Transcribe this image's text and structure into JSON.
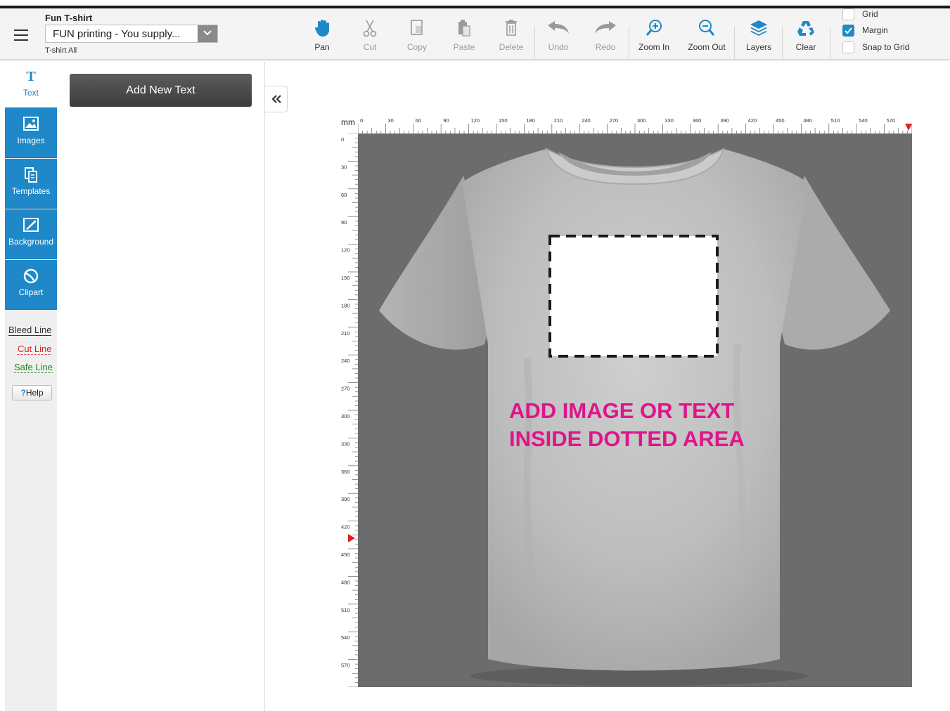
{
  "product": {
    "title": "Fun T-shirt",
    "selected_option": "FUN printing - You supply...",
    "subtitle": "T-shirt All"
  },
  "toolbar": {
    "tools": [
      {
        "label": "Pan",
        "icon": "hand-icon",
        "enabled": true
      },
      {
        "label": "Cut",
        "icon": "scissors-icon",
        "enabled": false
      },
      {
        "label": "Copy",
        "icon": "copy-icon",
        "enabled": false
      },
      {
        "label": "Paste",
        "icon": "paste-icon",
        "enabled": false
      },
      {
        "label": "Delete",
        "icon": "trash-icon",
        "enabled": false
      },
      {
        "label": "Undo",
        "icon": "undo-icon",
        "enabled": false
      },
      {
        "label": "Redo",
        "icon": "redo-icon",
        "enabled": false
      },
      {
        "label": "Zoom In",
        "icon": "zoom-in-icon",
        "enabled": true
      },
      {
        "label": "Zoom Out",
        "icon": "zoom-out-icon",
        "enabled": true
      },
      {
        "label": "Layers",
        "icon": "layers-icon",
        "enabled": true
      },
      {
        "label": "Clear",
        "icon": "recycle-icon",
        "enabled": true
      }
    ],
    "options": [
      {
        "label": "Grid",
        "checked": false
      },
      {
        "label": "Margin",
        "checked": true
      },
      {
        "label": "Snap to Grid",
        "checked": false
      }
    ]
  },
  "sidebar": {
    "tabs": [
      {
        "label": "Text",
        "icon": "text-icon",
        "active": true
      },
      {
        "label": "Images",
        "icon": "image-icon",
        "active": false
      },
      {
        "label": "Templates",
        "icon": "templates-icon",
        "active": false
      },
      {
        "label": "Background",
        "icon": "background-icon",
        "active": false
      },
      {
        "label": "Clipart",
        "icon": "clipart-icon",
        "active": false
      }
    ],
    "legend": [
      {
        "label": "Bleed Line",
        "color": "#333333"
      },
      {
        "label": "Cut Line",
        "color": "#e02020"
      },
      {
        "label": "Safe Line",
        "color": "#1f8a1f"
      }
    ],
    "help_label": "Help"
  },
  "panel": {
    "add_text_label": "Add New Text"
  },
  "canvas": {
    "unit_label": "mm",
    "ruler_ticks": [
      "0",
      "30",
      "60",
      "90",
      "120",
      "150",
      "180",
      "210",
      "240",
      "270",
      "300",
      "330",
      "360",
      "390",
      "420",
      "450",
      "480",
      "510",
      "540",
      "570"
    ],
    "overlay_line1": "ADD IMAGE OR TEXT",
    "overlay_line2": "INSIDE DOTTED AREA",
    "accent_color": "#1e88c8",
    "overlay_color": "#e0148a"
  }
}
